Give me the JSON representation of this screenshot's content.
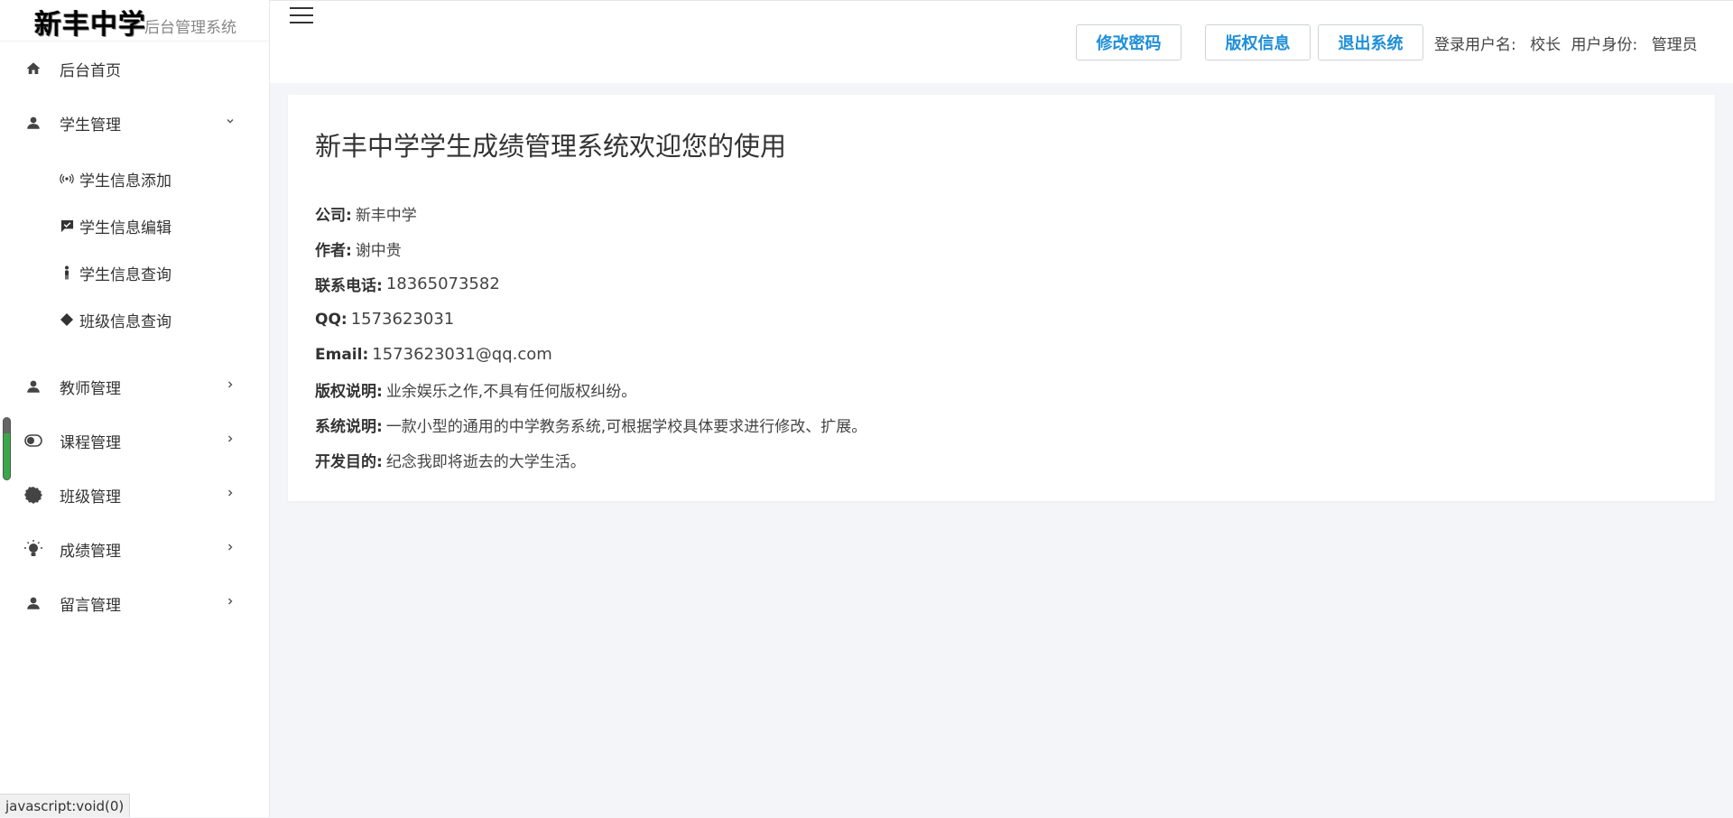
{
  "sidebar": {
    "logo_main": "新丰中学",
    "logo_sub": "后台管理系统",
    "menu": {
      "home": "后台首页",
      "student": "学生管理",
      "student_sub": {
        "add": "学生信息添加",
        "edit": "学生信息编辑",
        "query": "学生信息查询",
        "class_query": "班级信息查询"
      },
      "teacher": "教师管理",
      "course": "课程管理",
      "class": "班级管理",
      "score": "成绩管理",
      "message": "留言管理"
    }
  },
  "status_bar": {
    "text": "javascript:void(0)"
  },
  "header": {
    "change_password": "修改密码",
    "copyright": "版权信息",
    "logout": "退出系统",
    "user_label": "登录用户名:",
    "user_value": "校长",
    "role_label": "用户身份:",
    "role_value": "管理员"
  },
  "main": {
    "title": "新丰中学学生成绩管理系统欢迎您的使用",
    "info": {
      "company_label": "公司:",
      "company_value": "新丰中学",
      "author_label": "作者:",
      "author_value": "谢中贵",
      "phone_label": "联系电话:",
      "phone_value": "18365073582",
      "qq_label": "QQ:",
      "qq_value": "1573623031",
      "email_label": "Email:",
      "email_value": "1573623031@qq.com",
      "copyright_label": "版权说明:",
      "copyright_value": "业余娱乐之作,不具有任何版权纠纷。",
      "system_label": "系统说明:",
      "system_value": "一款小型的通用的中学教务系统,可根据学校具体要求进行修改、扩展。",
      "purpose_label": "开发目的:",
      "purpose_value": "纪念我即将逝去的大学生活。"
    }
  },
  "colors": {
    "accent": "#1f8fd8",
    "background": "#f4f5f8"
  }
}
